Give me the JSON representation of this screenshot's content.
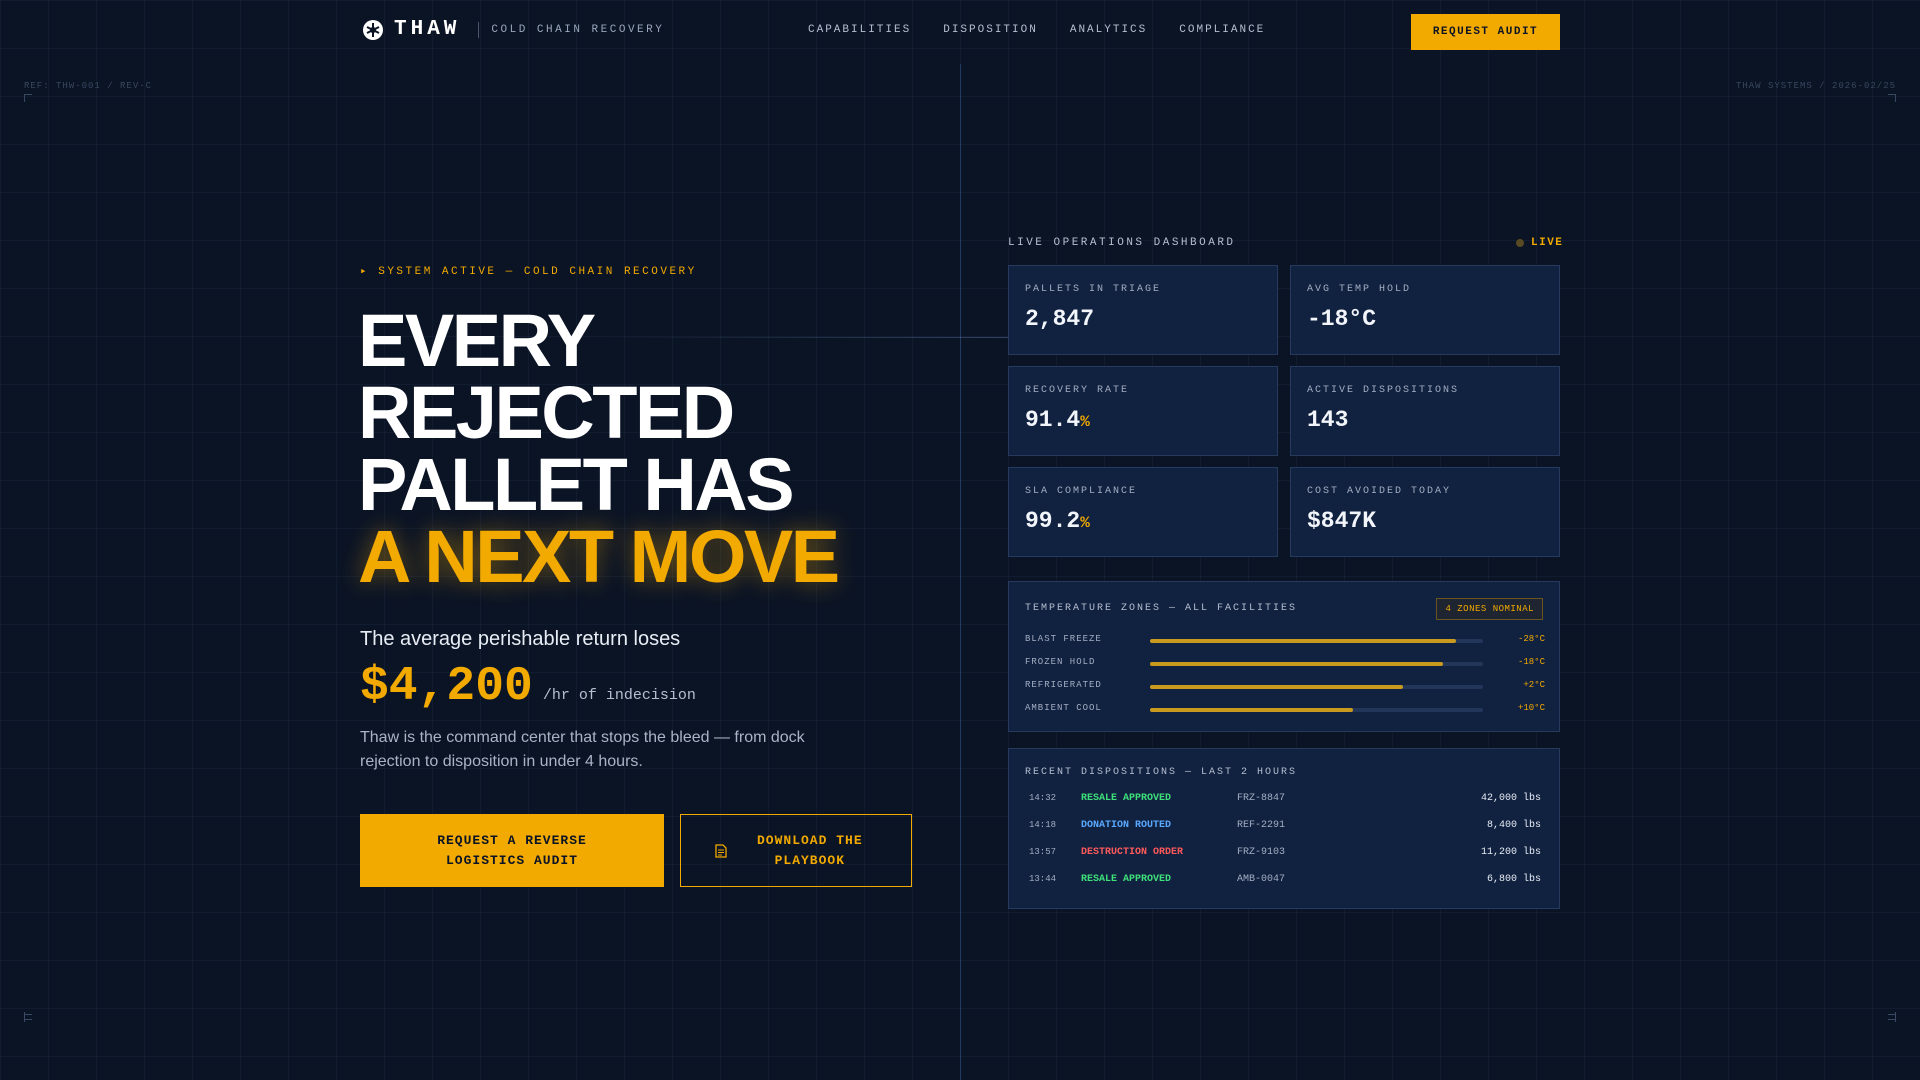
{
  "nav": {
    "brand": "THAW",
    "tagline": "COLD CHAIN RECOVERY",
    "links": [
      "CAPABILITIES",
      "DISPOSITION",
      "ANALYTICS",
      "COMPLIANCE"
    ],
    "cta": "REQUEST AUDIT",
    "logo_icon": "snowflake-badge-icon"
  },
  "meta": {
    "left": "REF: THW-001 / REV-C",
    "right": "THAW SYSTEMS / 2026-02/25"
  },
  "hero": {
    "status": "▸ SYSTEM ACTIVE — COLD CHAIN RECOVERY",
    "headline": [
      "EVERY",
      "REJECTED",
      "PALLET HAS"
    ],
    "headline_accent": "A NEXT MOVE",
    "sub_lead": "The average perishable return loses",
    "price": "$4,200",
    "price_unit": "/hr of indecision",
    "description": "Thaw is the command center that stops the bleed — from dock rejection to disposition in under 4 hours.",
    "primary_cta_line1": "REQUEST A REVERSE",
    "primary_cta_line2": "LOGISTICS AUDIT",
    "secondary_cta_line1": "DOWNLOAD THE",
    "secondary_cta_line2": "PLAYBOOK",
    "secondary_icon": "document-icon"
  },
  "dashboard": {
    "title": "LIVE OPERATIONS DASHBOARD",
    "live_label": "LIVE",
    "cards": [
      {
        "label": "PALLETS IN TRIAGE",
        "value": "2,847",
        "unit": ""
      },
      {
        "label": "AVG TEMP HOLD",
        "value": "-18°C",
        "unit": ""
      },
      {
        "label": "RECOVERY RATE",
        "value": "91.4",
        "unit": "%"
      },
      {
        "label": "ACTIVE DISPOSITIONS",
        "value": "143",
        "unit": ""
      },
      {
        "label": "SLA COMPLIANCE",
        "value": "99.2",
        "unit": "%"
      },
      {
        "label": "COST AVOIDED TODAY",
        "value": "$847K",
        "unit": ""
      }
    ],
    "zones": {
      "title": "TEMPERATURE ZONES — ALL FACILITIES",
      "badge": "4 ZONES NOMINAL",
      "rows": [
        {
          "name": "BLAST FREEZE",
          "temp": "-28°C",
          "level": 0.92
        },
        {
          "name": "FROZEN HOLD",
          "temp": "-18°C",
          "level": 0.88
        },
        {
          "name": "REFRIGERATED",
          "temp": "+2°C",
          "level": 0.76
        },
        {
          "name": "AMBIENT COOL",
          "temp": "+10°C",
          "level": 0.61
        }
      ]
    },
    "recent": {
      "title": "RECENT DISPOSITIONS — LAST 2 HOURS",
      "rows": [
        {
          "time": "14:32",
          "status": "RESALE APPROVED",
          "color": "#3ee07a",
          "id": "FRZ-8847",
          "weight": "42,000 lbs"
        },
        {
          "time": "14:18",
          "status": "DONATION ROUTED",
          "color": "#5aa8ff",
          "id": "REF-2291",
          "weight": "8,400 lbs"
        },
        {
          "time": "13:57",
          "status": "DESTRUCTION ORDER",
          "color": "#ff5a5a",
          "id": "FRZ-9103",
          "weight": "11,200 lbs"
        },
        {
          "time": "13:44",
          "status": "RESALE APPROVED",
          "color": "#3ee07a",
          "id": "AMB-0047",
          "weight": "6,800 lbs"
        }
      ]
    }
  },
  "colors": {
    "accent": "#f2a900",
    "background": "#0b1425",
    "card": "#112140"
  }
}
